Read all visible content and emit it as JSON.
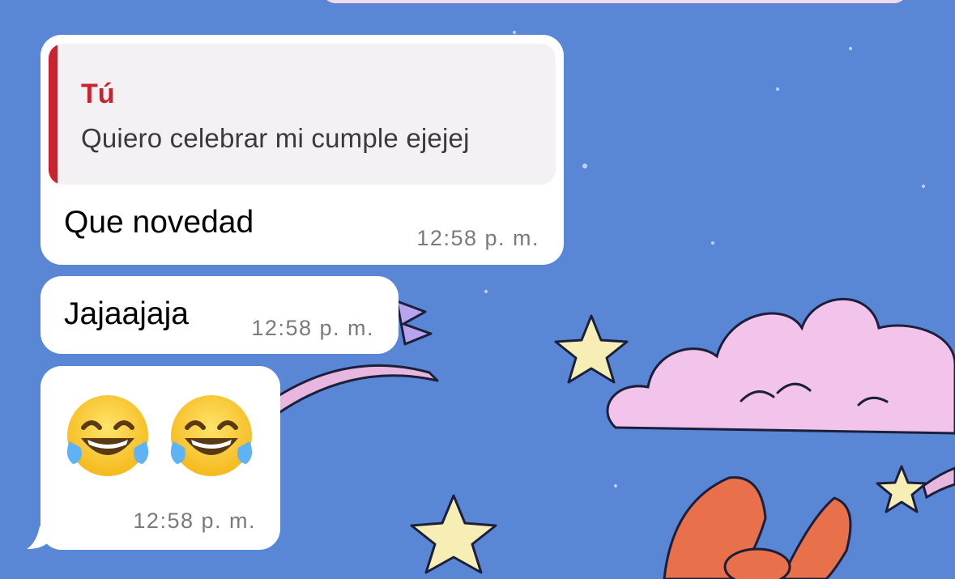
{
  "chat": {
    "messages": [
      {
        "quote": {
          "author": "Tú",
          "text": "Quiero celebrar mi cumple ejejej"
        },
        "text": "Que novedad",
        "time": "12:58 p. m."
      },
      {
        "text": "Jajaajaja",
        "time": "12:58 p. m."
      },
      {
        "emojis": [
          "😂",
          "😂"
        ],
        "emoji_icon": "face-with-tears-of-joy-icon",
        "time": "12:58 p. m."
      }
    ]
  },
  "theme": {
    "wallpaper": "#5a86d6",
    "bubble": "#ffffff",
    "quote_bg": "#f3f1f3",
    "quote_accent": "#c8232f",
    "timestamp": "#7a7a7e"
  }
}
